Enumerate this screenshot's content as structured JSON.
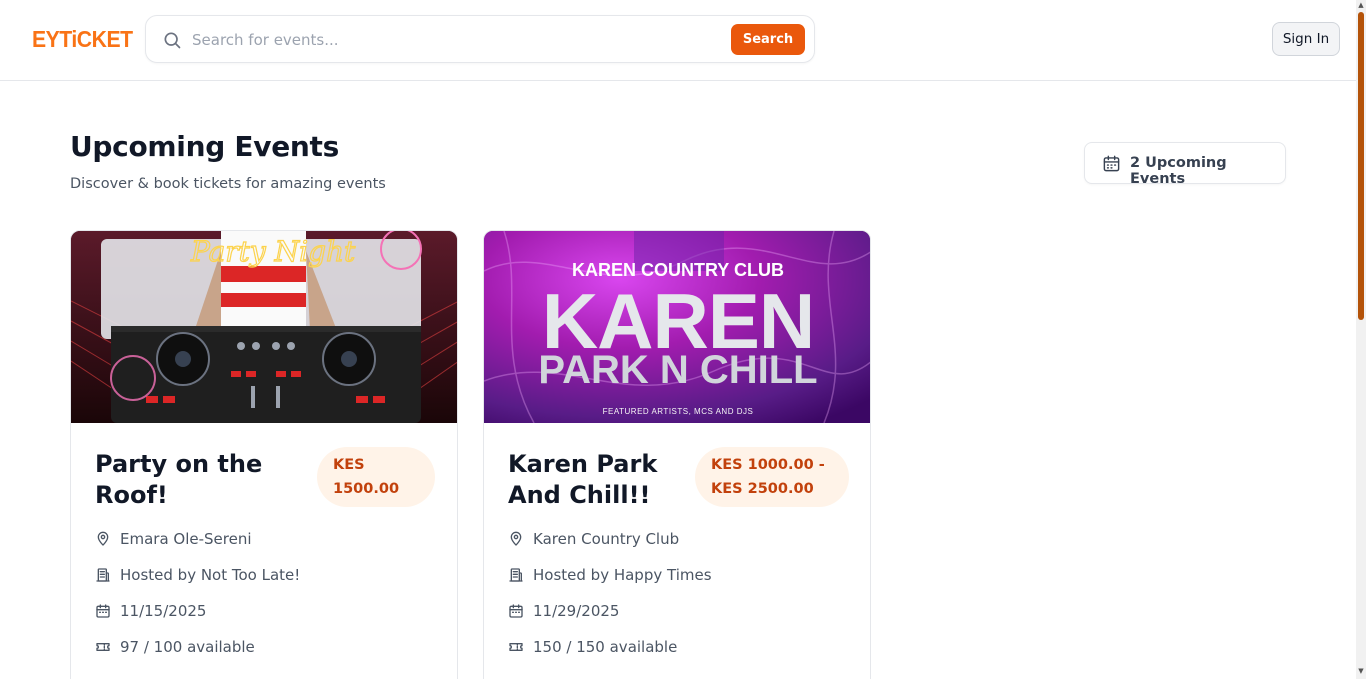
{
  "header": {
    "logo_text": "EYTiCKET",
    "search": {
      "placeholder": "Search for events...",
      "value": "",
      "button_label": "Search"
    },
    "signin_label": "Sign In"
  },
  "main": {
    "title": "Upcoming Events",
    "subtitle": "Discover & book tickets for amazing events",
    "count_label": "2 Upcoming Events"
  },
  "events": [
    {
      "title": "Party on the Roof!",
      "price": "KES 1500.00",
      "location": "Emara Ole-Sereni",
      "host": "Hosted by Not Too Late!",
      "date": "11/15/2025",
      "availability": "97 / 100 available",
      "image_text": "Party Night"
    },
    {
      "title": "Karen Park And Chill!!",
      "price": "KES 1000.00 - KES 2500.00",
      "location": "Karen Country Club",
      "host": "Hosted by Happy Times",
      "date": "11/29/2025",
      "availability": "150 / 150 available",
      "image_text": {
        "top": "KAREN COUNTRY CLUB",
        "big": "KAREN",
        "sub": "PARK N CHILL",
        "small": "FEATURED ARTISTS, MCS AND DJS"
      }
    }
  ],
  "colors": {
    "brand": "#ea580c",
    "price_bg": "#fff3e8",
    "price_text": "#c2410c"
  },
  "icons": [
    "search-icon",
    "calendar-icon",
    "map-pin-icon",
    "building-icon",
    "ticket-icon"
  ]
}
